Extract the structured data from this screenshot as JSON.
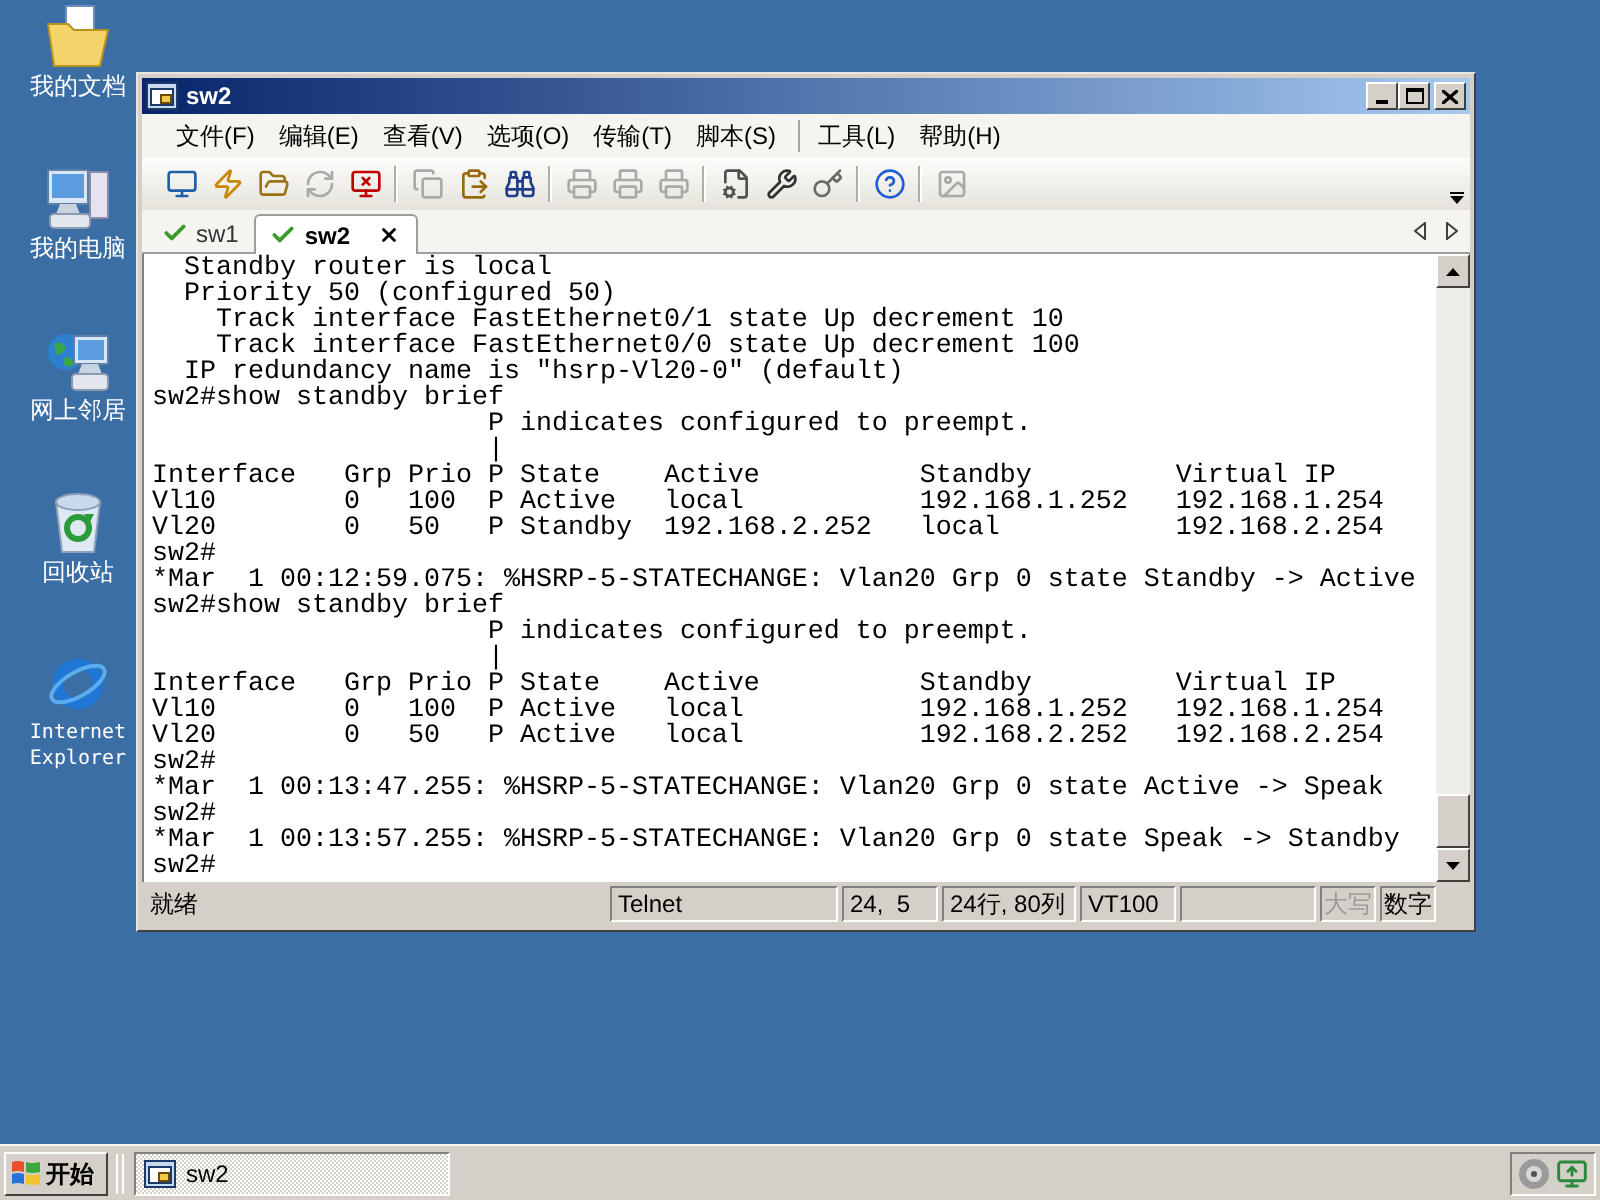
{
  "desktop_icons": [
    {
      "label": "我的文档",
      "kind": "documents"
    },
    {
      "label": "我的电脑",
      "kind": "computer"
    },
    {
      "label": "网上邻居",
      "kind": "network"
    },
    {
      "label": "回收站",
      "kind": "recycle_bin"
    },
    {
      "label": "Internet Explorer",
      "kind": "browser"
    }
  ],
  "window": {
    "title": "sw2",
    "menu_groups": [
      [
        "文件(F)",
        "编辑(E)",
        "查看(V)",
        "选项(O)",
        "传输(T)",
        "脚本(S)"
      ],
      [
        "工具(L)",
        "帮助(H)"
      ]
    ],
    "toolbar_groups": [
      [
        {
          "kind": "connect",
          "disabled": false
        },
        {
          "kind": "quick_connect",
          "disabled": false
        },
        {
          "kind": "connect_tab",
          "disabled": false
        },
        {
          "kind": "reconnect",
          "disabled": true
        },
        {
          "kind": "disconnect",
          "disabled": false
        }
      ],
      [
        {
          "kind": "copy",
          "disabled": true
        },
        {
          "kind": "paste",
          "disabled": false
        },
        {
          "kind": "find",
          "disabled": false
        }
      ],
      [
        {
          "kind": "print",
          "disabled": true
        },
        {
          "kind": "print_selection",
          "disabled": true
        },
        {
          "kind": "print_setup",
          "disabled": true
        }
      ],
      [
        {
          "kind": "session_options",
          "disabled": false
        },
        {
          "kind": "global_options",
          "disabled": false
        },
        {
          "kind": "keymap",
          "disabled": false
        }
      ],
      [
        {
          "kind": "help",
          "disabled": false
        }
      ],
      [
        {
          "kind": "thumbnail",
          "disabled": true
        }
      ]
    ],
    "tabs": [
      {
        "label": "sw1",
        "selected": false,
        "connected": true
      },
      {
        "label": "sw2",
        "selected": true,
        "connected": true
      }
    ],
    "terminal": {
      "lines": [
        "  Standby router is local",
        "  Priority 50 (configured 50)",
        "    Track interface FastEthernet0/1 state Up decrement 10",
        "    Track interface FastEthernet0/0 state Up decrement 100",
        "  IP redundancy name is \"hsrp-Vl20-0\" (default)",
        "sw2#show standby brief",
        "                     P indicates configured to preempt.",
        "                     |",
        "Interface   Grp Prio P State    Active          Standby         Virtual IP",
        "Vl10        0   100  P Active   local           192.168.1.252   192.168.1.254",
        "Vl20        0   50   P Standby  192.168.2.252   local           192.168.2.254",
        "sw2#",
        "*Mar  1 00:12:59.075: %HSRP-5-STATECHANGE: Vlan20 Grp 0 state Standby -> Active",
        "sw2#show standby brief",
        "                     P indicates configured to preempt.",
        "                     |",
        "Interface   Grp Prio P State    Active          Standby         Virtual IP",
        "Vl10        0   100  P Active   local           192.168.1.252   192.168.1.254",
        "Vl20        0   50   P Active   local           192.168.2.252   192.168.2.254",
        "sw2#",
        "*Mar  1 00:13:47.255: %HSRP-5-STATECHANGE: Vlan20 Grp 0 state Active -> Speak",
        "sw2#",
        "*Mar  1 00:13:57.255: %HSRP-5-STATECHANGE: Vlan20 Grp 0 state Speak -> Standby",
        "sw2#"
      ]
    },
    "status_bar": {
      "message": "就绪",
      "panels": [
        "Telnet",
        "24,  5",
        "24行, 80列",
        "VT100"
      ],
      "indicators": [
        {
          "label": "大写",
          "on": false
        },
        {
          "label": "数字",
          "on": true
        }
      ]
    }
  },
  "taskbar": {
    "start": "开始",
    "tasks": [
      {
        "label": "sw2",
        "selected": true
      }
    ]
  }
}
